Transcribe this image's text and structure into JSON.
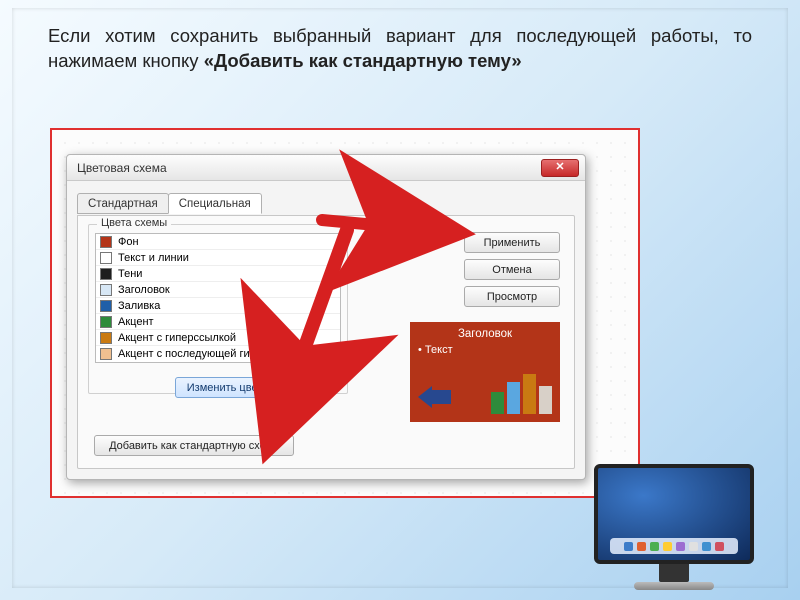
{
  "slide": {
    "text_before": "Если хотим сохранить выбранный вариант для последующей работы, то нажимаем кнопку ",
    "text_bold": "«Добавить как стандартную тему»"
  },
  "dialog": {
    "title": "Цветовая схема",
    "close_glyph": "✕",
    "tabs": {
      "standard": "Стандартная",
      "special": "Специальная"
    },
    "group_label": "Цвета схемы",
    "colors": [
      {
        "hex": "#b33418",
        "label": "Фон"
      },
      {
        "hex": "#ffffff",
        "label": "Текст и линии"
      },
      {
        "hex": "#1e1e1e",
        "label": "Тени"
      },
      {
        "hex": "#d7e7f5",
        "label": "Заголовок"
      },
      {
        "hex": "#1f5fa8",
        "label": "Заливка"
      },
      {
        "hex": "#2e8b3b",
        "label": "Акцент"
      },
      {
        "hex": "#c97a12",
        "label": "Акцент с гиперссылкой"
      },
      {
        "hex": "#f0c090",
        "label": "Акцент с последующей гиперссылкой"
      }
    ],
    "buttons": {
      "apply": "Применить",
      "cancel": "Отмена",
      "preview": "Просмотр",
      "change_color": "Изменить цвет…",
      "add_scheme": "Добавить как стандартную схему"
    },
    "preview": {
      "title": "Заголовок",
      "text": "Текст"
    }
  }
}
